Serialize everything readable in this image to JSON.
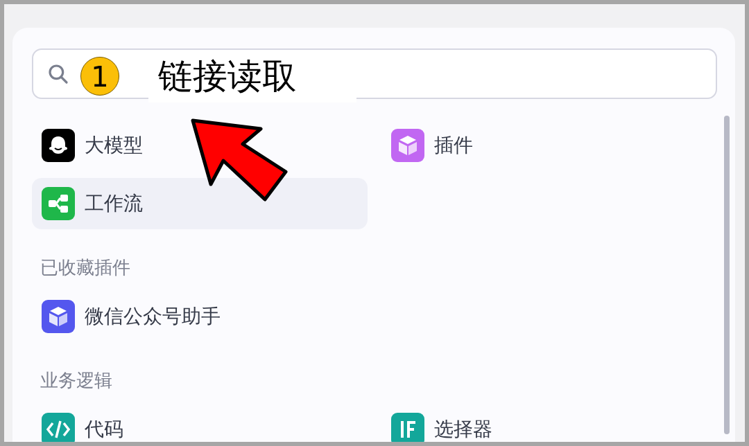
{
  "annotation": {
    "badge": "1",
    "label": "链接读取"
  },
  "groups": [
    {
      "items": [
        {
          "label": "大模型",
          "kind": "ghost",
          "color": "#000000",
          "selected": false
        },
        {
          "label": "插件",
          "kind": "cube",
          "color": "#c167f2",
          "selected": false
        },
        {
          "label": "工作流",
          "kind": "flow",
          "color": "#1fb74a",
          "selected": true
        }
      ]
    },
    {
      "title": "已收藏插件",
      "items": [
        {
          "label": "微信公众号助手",
          "kind": "cube",
          "color": "#5457ee",
          "selected": false
        }
      ]
    },
    {
      "title": "业务逻辑",
      "items": [
        {
          "label": "代码",
          "kind": "code",
          "color": "#13a79a",
          "selected": false
        },
        {
          "label": "选择器",
          "kind": "if",
          "color": "#13a79a",
          "selected": false
        }
      ]
    }
  ]
}
